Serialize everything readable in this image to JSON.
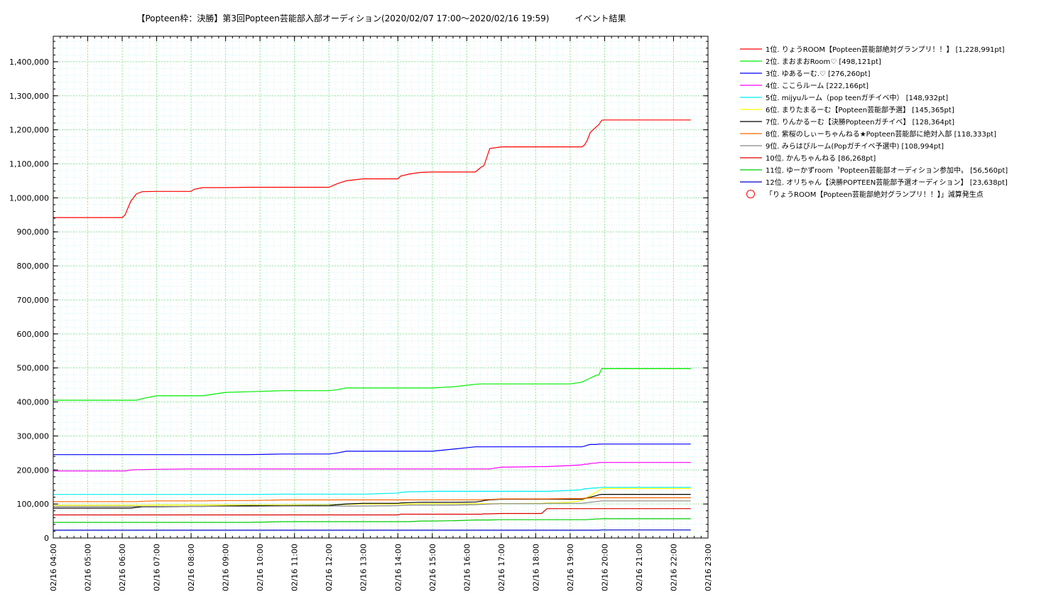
{
  "chart_data": {
    "type": "line",
    "title": "【Popteen枠：決勝】第3回Popteen芸能部入部オーディション(2020/02/07 17:00～2020/02/16 19:59)　　　イベント結果",
    "xlabel": "",
    "ylabel": "",
    "x_unit": "hours",
    "x_range": [
      "02/16 04:00",
      "02/16 23:00"
    ],
    "x_ticks": [
      "02/16 04:00",
      "02/16 05:00",
      "02/16 06:00",
      "02/16 07:00",
      "02/16 08:00",
      "02/16 09:00",
      "02/16 10:00",
      "02/16 11:00",
      "02/16 12:00",
      "02/16 13:00",
      "02/16 14:00",
      "02/16 15:00",
      "02/16 16:00",
      "02/16 17:00",
      "02/16 18:00",
      "02/16 19:00",
      "02/16 20:00",
      "02/16 21:00",
      "02/16 22:00",
      "02/16 23:00"
    ],
    "ylim": [
      0,
      1475000
    ],
    "y_ticks": [
      0,
      100000,
      200000,
      300000,
      400000,
      500000,
      600000,
      700000,
      800000,
      900000,
      1000000,
      1100000,
      1200000,
      1300000,
      1400000
    ],
    "y_tick_labels": [
      "0",
      "100,000",
      "200,000",
      "300,000",
      "400,000",
      "500,000",
      "600,000",
      "700,000",
      "800,000",
      "900,000",
      "1,000,000",
      "1,100,000",
      "1,200,000",
      "1,300,000",
      "1,400,000"
    ],
    "grid": true,
    "legend_position": "right",
    "x_time_values": [
      "02/16 04:00",
      "02/16 06:00",
      "02/16 06:05",
      "02/16 06:15",
      "02/16 06:25",
      "02/16 06:35",
      "02/16 07:00",
      "02/16 08:00",
      "02/16 08:05",
      "02/16 08:20",
      "02/16 09:00",
      "02/16 09:40",
      "02/16 10:40",
      "02/16 12:00",
      "02/16 12:15",
      "02/16 12:30",
      "02/16 13:00",
      "02/16 14:00",
      "02/16 14:05",
      "02/16 14:20",
      "02/16 14:40",
      "02/16 15:00",
      "02/16 15:40",
      "02/16 16:15",
      "02/16 16:25",
      "02/16 16:30",
      "02/16 16:40",
      "02/16 17:00",
      "02/16 18:10",
      "02/16 18:20",
      "02/16 19:00",
      "02/16 19:20",
      "02/16 19:25",
      "02/16 19:30",
      "02/16 19:35",
      "02/16 19:40",
      "02/16 19:45",
      "02/16 19:50",
      "02/16 19:55",
      "02/16 20:00",
      "02/16 22:30"
    ],
    "series": [
      {
        "name": "1位. りょうROOM【Popteen芸能部絶対グランプリ！！】 [1,228,991pt]",
        "color": "#ff0000",
        "values": [
          942000,
          942000,
          950000,
          990000,
          1012000,
          1018000,
          1019000,
          1019000,
          1025000,
          1030000,
          1030000,
          1031000,
          1031000,
          1031000,
          1042000,
          1050000,
          1056000,
          1056000,
          1064000,
          1070000,
          1075000,
          1076000,
          1076000,
          1076000,
          1090000,
          1095000,
          1145000,
          1150000,
          1150000,
          1150000,
          1150000,
          1150000,
          1155000,
          1170000,
          1192000,
          1200000,
          1208000,
          1215000,
          1228000,
          1228991,
          1228991
        ]
      },
      {
        "name": "2位. まおまおRoom♡ [498,121pt]",
        "color": "#00ee00",
        "values": [
          405000,
          405000,
          405000,
          405000,
          405000,
          410000,
          418000,
          418000,
          418000,
          418000,
          428000,
          430000,
          433000,
          433000,
          436000,
          441000,
          441000,
          441000,
          441000,
          441000,
          441000,
          441000,
          445000,
          452000,
          453000,
          453000,
          453000,
          453000,
          453000,
          453000,
          453000,
          458000,
          462000,
          466000,
          470000,
          474000,
          478000,
          480000,
          498000,
          498121,
          498121
        ]
      },
      {
        "name": "3位. ゆあるーむ.♡ [276,260pt]",
        "color": "#0000ff",
        "values": [
          245000,
          245000,
          245000,
          245000,
          245000,
          245000,
          245000,
          245000,
          245000,
          245000,
          245000,
          245000,
          247000,
          247000,
          250000,
          255000,
          255000,
          255000,
          255000,
          255000,
          255000,
          255000,
          262000,
          268000,
          268000,
          268000,
          268000,
          268000,
          268000,
          268000,
          268000,
          268000,
          270000,
          273000,
          275000,
          275000,
          275000,
          276000,
          276260,
          276260,
          276260
        ]
      },
      {
        "name": "4位. ここらルーム [222,166pt]",
        "color": "#ff00ff",
        "values": [
          197000,
          197000,
          197000,
          200000,
          201000,
          201000,
          202000,
          203000,
          203000,
          203000,
          203000,
          203000,
          203000,
          203000,
          203000,
          203000,
          203000,
          203000,
          203000,
          203000,
          203000,
          203000,
          203000,
          203000,
          203000,
          203000,
          203000,
          208000,
          210000,
          210000,
          213000,
          215000,
          217000,
          217000,
          219000,
          220000,
          220000,
          222000,
          222166,
          222166,
          222166
        ]
      },
      {
        "name": "5位. mijyuルーム（pop teenガチイベ中） [148,932pt]",
        "color": "#00eeee",
        "values": [
          128000,
          128000,
          128000,
          128000,
          128000,
          128000,
          128000,
          128000,
          128000,
          128000,
          128000,
          128000,
          129000,
          129000,
          129000,
          129000,
          129000,
          132000,
          134000,
          136000,
          136000,
          137000,
          137000,
          137000,
          137000,
          137000,
          137000,
          137000,
          137000,
          137000,
          140000,
          142000,
          145000,
          145000,
          146000,
          147000,
          147000,
          148000,
          148932,
          148932,
          148932
        ]
      },
      {
        "name": "6位. まりたまるーむ【Popteen芸能部予選】 [145,365pt]",
        "color": "#ffff00",
        "values": [
          96000,
          96000,
          96000,
          96000,
          96000,
          96000,
          97000,
          97000,
          97000,
          97000,
          97000,
          97000,
          97000,
          97000,
          98000,
          99000,
          100000,
          100000,
          100000,
          100000,
          101000,
          101000,
          101000,
          101000,
          101000,
          101000,
          101000,
          101000,
          102000,
          103000,
          105000,
          110000,
          115000,
          120000,
          125000,
          130000,
          135000,
          140000,
          145365,
          145365,
          145365
        ]
      },
      {
        "name": "7位. りんかるーむ【決勝Popteenガチイベ】 [128,364pt]",
        "color": "#000000",
        "values": [
          88000,
          88000,
          88000,
          88000,
          90000,
          92000,
          92000,
          93000,
          93000,
          93000,
          94000,
          95000,
          95000,
          96000,
          98000,
          100000,
          102000,
          102000,
          103000,
          104000,
          105000,
          105000,
          105000,
          106000,
          108000,
          110000,
          112000,
          114000,
          114000,
          114000,
          114000,
          114000,
          116000,
          118000,
          120000,
          122000,
          124000,
          127000,
          128364,
          128364,
          128364
        ]
      },
      {
        "name": "8位. 紫桜のしぃーちゃんねる★Popteen芸能部に絶対入部 [118,333pt]",
        "color": "#ff6600",
        "values": [
          107000,
          107000,
          107000,
          107000,
          107000,
          108000,
          109000,
          109000,
          109000,
          109000,
          110000,
          110000,
          112000,
          112000,
          112000,
          112000,
          112000,
          112000,
          112000,
          112000,
          112000,
          112000,
          112000,
          112000,
          112000,
          113000,
          113000,
          115000,
          115000,
          115000,
          116000,
          116000,
          117000,
          117000,
          118000,
          118000,
          118000,
          118000,
          118333,
          118333,
          118333
        ]
      },
      {
        "name": "9位. みらはびルーム(Popガチイベ予選中) [108,994pt]",
        "color": "#888888",
        "values": [
          93000,
          93000,
          93000,
          93000,
          93000,
          93000,
          93000,
          93000,
          93000,
          93000,
          93000,
          93000,
          94000,
          94000,
          94000,
          94000,
          94000,
          95000,
          96000,
          97000,
          97000,
          97000,
          97000,
          98000,
          99000,
          99000,
          100000,
          101000,
          101000,
          102000,
          102000,
          102000,
          103000,
          104000,
          105000,
          106000,
          107000,
          108000,
          108994,
          108994,
          108994
        ]
      },
      {
        "name": "10位. かんちゃんねる [86,268pt]",
        "color": "#dd0000",
        "values": [
          68000,
          68000,
          68000,
          68000,
          68000,
          68000,
          68000,
          68000,
          68000,
          68000,
          68000,
          68000,
          68000,
          68000,
          68000,
          68000,
          68000,
          68000,
          70000,
          70000,
          70000,
          70000,
          70000,
          70000,
          70000,
          71000,
          71000,
          72000,
          72000,
          86268,
          86268,
          86268,
          86268,
          86268,
          86268,
          86268,
          86268,
          86268,
          86268,
          86268,
          86268
        ]
      },
      {
        "name": "11位. ゆーかずroom〝Popteen芸能部オーディション参加中〟 [56,560pt]",
        "color": "#00cc00",
        "values": [
          46000,
          46000,
          46000,
          46000,
          46000,
          46000,
          46000,
          46000,
          46000,
          46000,
          46000,
          46000,
          48000,
          48000,
          48000,
          48000,
          48000,
          48000,
          48000,
          48000,
          50000,
          50000,
          51000,
          53000,
          53000,
          53000,
          53000,
          54000,
          54000,
          54000,
          54000,
          54000,
          54000,
          54000,
          55000,
          55000,
          56000,
          56000,
          56560,
          56560,
          56560
        ]
      },
      {
        "name": "12位. オリちゃん【決勝POPTEEN芸能部予選オーディション】 [23,638pt]",
        "color": "#0000cc",
        "values": [
          23000,
          23000,
          23000,
          23000,
          23000,
          23000,
          23000,
          23000,
          23000,
          23000,
          23000,
          23000,
          23000,
          23000,
          23000,
          23000,
          23000,
          23000,
          23000,
          23000,
          23000,
          23000,
          23000,
          23000,
          23000,
          23000,
          23000,
          23000,
          23000,
          23000,
          23000,
          23000,
          23000,
          23000,
          23000,
          23000,
          23000,
          23000,
          23638,
          23638,
          23638
        ]
      }
    ],
    "marker_legend": {
      "name": "「りょうROOM【Popteen芸能部絶対グランプリ！！】」減算発生点",
      "color": "#ff0000",
      "shape": "circle"
    }
  }
}
